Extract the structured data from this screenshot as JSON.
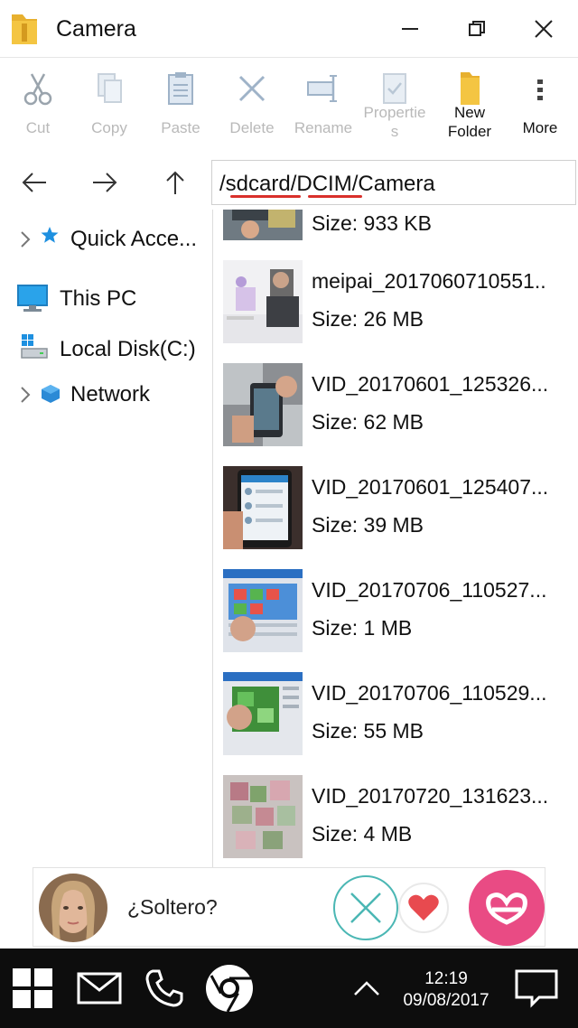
{
  "window": {
    "title": "Camera",
    "controls": {
      "minimize": "minimize-icon",
      "restore": "restore-icon",
      "close": "close-icon"
    }
  },
  "toolbar": {
    "cut": "Cut",
    "copy": "Copy",
    "paste": "Paste",
    "delete": "Delete",
    "rename": "Rename",
    "properties_line1": "Propertie",
    "properties_line2": "s",
    "new_folder_line1": "New",
    "new_folder_line2": "Folder",
    "more": "More"
  },
  "address": {
    "seg1": "/",
    "seg2": "sdcard",
    "seg3": "/",
    "seg4": "DCIM",
    "seg5": "/Camera"
  },
  "sidebar": {
    "items": [
      {
        "label": "Quick Acce...",
        "icon": "star-icon",
        "expandable": true
      },
      {
        "label": "This PC",
        "icon": "monitor-icon",
        "expandable": false
      },
      {
        "label": "Local Disk(C:)",
        "icon": "disk-icon",
        "expandable": false
      },
      {
        "label": "Network",
        "icon": "network-icon",
        "expandable": true
      }
    ]
  },
  "files": [
    {
      "name": "",
      "size": "Size: 933 KB"
    },
    {
      "name": "meipai_2017060710551..",
      "size": "Size: 26 MB"
    },
    {
      "name": "VID_20170601_125326...",
      "size": "Size: 62 MB"
    },
    {
      "name": "VID_20170601_125407...",
      "size": "Size: 39 MB"
    },
    {
      "name": "VID_20170706_110527...",
      "size": "Size: 1 MB"
    },
    {
      "name": "VID_20170706_110529...",
      "size": "Size: 55 MB"
    },
    {
      "name": "VID_20170720_131623...",
      "size": "Size: 4 MB"
    }
  ],
  "ad": {
    "text": "¿Soltero?",
    "accent": "#e94b84",
    "dismiss_color": "#4bb7b4"
  },
  "taskbar": {
    "time": "12:19",
    "date": "09/08/2017"
  },
  "colors": {
    "folder": "#f4c542",
    "accent_blue": "#1e90e0",
    "spell_underline": "#d9302b",
    "disabled_text": "#b9b9b9"
  }
}
